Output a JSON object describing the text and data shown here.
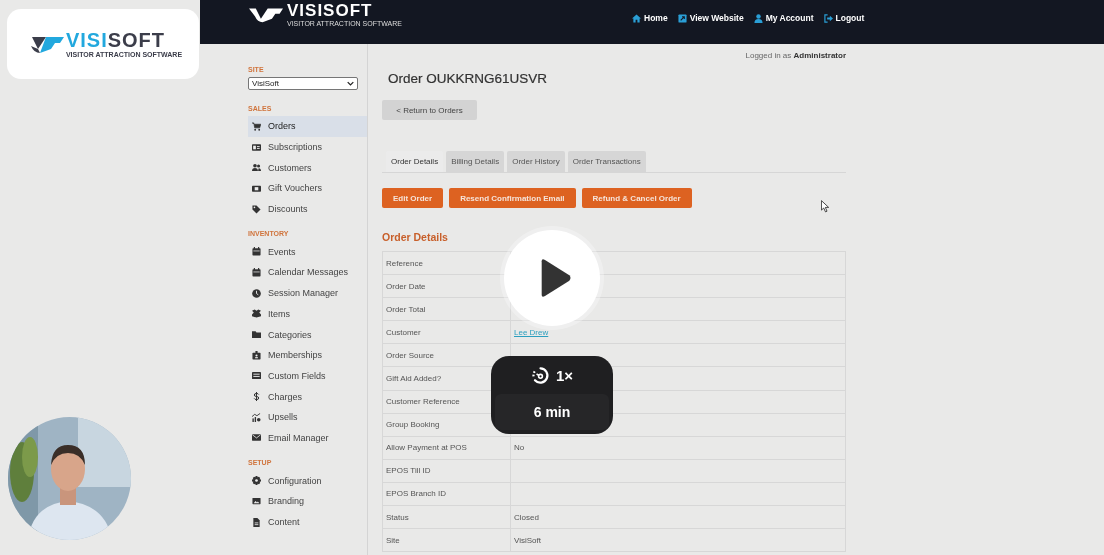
{
  "video_overlay": {
    "speed": "1×",
    "duration": "6 min"
  },
  "brand": {
    "first": "VISI",
    "second": "SOFT",
    "tagline": "VISITOR ATTRACTION SOFTWARE"
  },
  "header": {
    "brand": "VISISOFT",
    "tagline": "VISITOR ATTRACTION SOFTWARE",
    "nav": [
      {
        "label": "Home"
      },
      {
        "label": "View Website"
      },
      {
        "label": "My Account"
      },
      {
        "label": "Logout"
      }
    ]
  },
  "logged_in": "Logged in as **Administrator**",
  "sidebar": {
    "site_label": "SITE",
    "site_value": "VisiSoft",
    "sections": [
      {
        "title": "SALES",
        "items": [
          {
            "label": "Orders",
            "selected": true
          },
          {
            "label": "Subscriptions",
            "selected": false
          },
          {
            "label": "Customers",
            "selected": false
          },
          {
            "label": "Gift Vouchers",
            "selected": false
          },
          {
            "label": "Discounts",
            "selected": false
          }
        ]
      },
      {
        "title": "INVENTORY",
        "items": [
          {
            "label": "Events",
            "selected": false
          },
          {
            "label": "Calendar Messages",
            "selected": false
          },
          {
            "label": "Session Manager",
            "selected": false
          },
          {
            "label": "Items",
            "selected": false
          },
          {
            "label": "Categories",
            "selected": false
          },
          {
            "label": "Memberships",
            "selected": false
          },
          {
            "label": "Custom Fields",
            "selected": false
          },
          {
            "label": "Charges",
            "selected": false
          },
          {
            "label": "Upsells",
            "selected": false
          },
          {
            "label": "Email Manager",
            "selected": false
          }
        ]
      },
      {
        "title": "SETUP",
        "items": [
          {
            "label": "Configuration",
            "selected": false
          },
          {
            "label": "Branding",
            "selected": false
          },
          {
            "label": "Content",
            "selected": false
          }
        ]
      }
    ]
  },
  "page": {
    "title": "Order OUKKRNG61USVR",
    "back_button": "< Return to Orders",
    "tabs": [
      {
        "label": "Order Details",
        "selected": true
      },
      {
        "label": "Billing Details",
        "selected": false
      },
      {
        "label": "Order History",
        "selected": false
      },
      {
        "label": "Order Transactions",
        "selected": false
      }
    ],
    "actions": [
      "Edit Order",
      "Resend Confirmation Email",
      "Refund & Cancel Order"
    ],
    "section_title": "Order Details",
    "details": [
      {
        "label": "Reference"
      },
      {
        "label": "Order Date"
      },
      {
        "label": "Order Total"
      },
      {
        "label": "Customer",
        "value": "Lee Drew",
        "kind": "link"
      },
      {
        "label": "Order Source"
      },
      {
        "label": "Gift Aid Added?"
      },
      {
        "label": "Customer Reference"
      },
      {
        "label": "Group Booking"
      },
      {
        "label": "Allow Payment at POS",
        "value": "No",
        "kind": "text"
      },
      {
        "label": "EPOS Till ID"
      },
      {
        "label": "EPOS Branch ID"
      },
      {
        "label": "Status",
        "value": "Closed",
        "kind": "text"
      },
      {
        "label": "Site",
        "value": "VisiSoft",
        "kind": "text"
      }
    ]
  }
}
